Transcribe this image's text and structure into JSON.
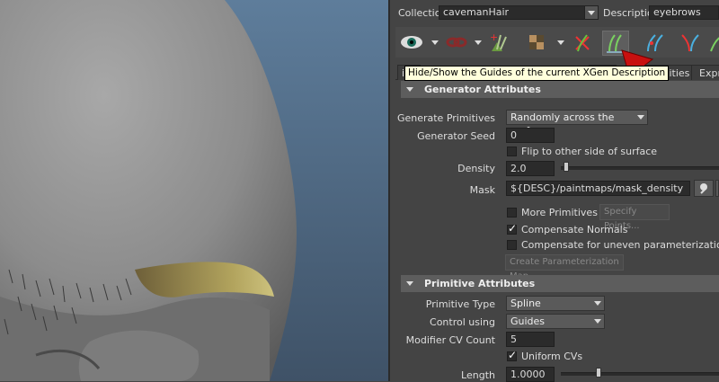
{
  "header": {
    "collection_label": "Collection",
    "collection_value": "cavemanHair",
    "description_label": "Description",
    "description_value": "eyebrows"
  },
  "toolbar": {
    "icons": [
      "eye-icon",
      "link-icon",
      "add-primitive-icon",
      "texture-icon",
      "delete-guide-icon",
      "guides-icon",
      "rebuild-guides-icon",
      "attract-guides-icon",
      "guide-curve-icon"
    ],
    "tooltip": "Hide/Show the Guides of the current XGen Description",
    "annotation_color": "#c81010"
  },
  "tabs": [
    {
      "label": "ive"
    },
    {
      "label": "ing"
    },
    {
      "label": "Utilities"
    },
    {
      "label": "Expre"
    }
  ],
  "generator": {
    "title": "Generator Attributes",
    "generate_primitives_label": "Generate Primitives",
    "generate_primitives_value": "Randomly across the surface",
    "seed_label": "Generator Seed",
    "seed_value": "0",
    "flip_label": "Flip to other side of surface",
    "flip_checked": false,
    "density_label": "Density",
    "density_value": "2.0",
    "mask_label": "Mask",
    "mask_value": "${DESC}/paintmaps/mask_density",
    "more_primitives_label": "More Primitives at",
    "more_primitives_checked": false,
    "specify_points_label": "Specify Points...",
    "compensate_normals_label": "Compensate Normals",
    "compensate_normals_checked": true,
    "compensate_uneven_label": "Compensate for uneven parameterization",
    "compensate_uneven_checked": false,
    "create_map_label": "Create Parameterization Map"
  },
  "primitive": {
    "title": "Primitive Attributes",
    "type_label": "Primitive Type",
    "type_value": "Spline",
    "control_label": "Control using",
    "control_value": "Guides",
    "modifier_label": "Modifier CV Count",
    "modifier_value": "5",
    "uniform_label": "Uniform CVs",
    "uniform_checked": true,
    "length_label": "Length",
    "length_value": "1.0000"
  }
}
